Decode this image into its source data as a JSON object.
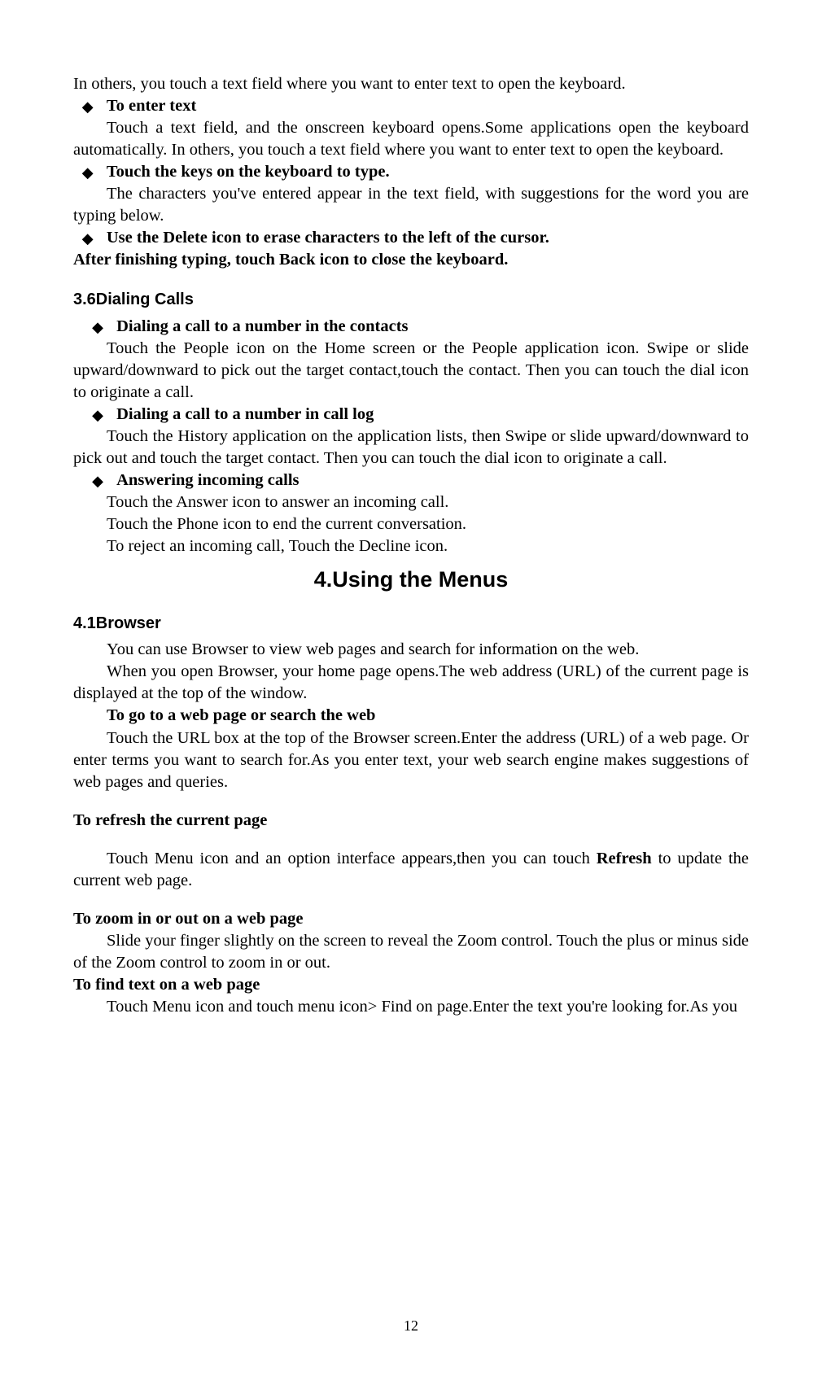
{
  "intro_line": "In others, you touch a text field where you want to enter text to open the keyboard.",
  "enter_text": {
    "heading": "To enter text",
    "body": "Touch a text field, and the onscreen keyboard opens.Some applications open the keyboard automatically. In others, you touch a text field where you want to enter text to open the keyboard."
  },
  "touch_keys": {
    "heading": "Touch the keys on the keyboard to type.",
    "body": "The characters you've entered appear in the text field, with suggestions for the word you are typing below."
  },
  "delete_icon": {
    "heading": "Use the Delete icon to erase characters to the left of the cursor."
  },
  "finish_typing": "After finishing typing, touch Back icon to close the keyboard.",
  "sec_36": {
    "title": "3.6Dialing Calls",
    "contacts": {
      "heading": "Dialing a call to a number in the contacts",
      "body": "Touch the People icon on the Home screen or the People application icon. Swipe or slide upward/downward to pick out the target contact,touch the contact. Then you can touch the dial icon to originate a call."
    },
    "call_log": {
      "heading": "Dialing a call to a number in call log",
      "body": "Touch the History application on the application lists, then Swipe or slide upward/downward to pick out and touch the target contact. Then you can touch the dial icon to originate a call."
    },
    "answering": {
      "heading": "Answering incoming calls",
      "line1": "Touch the Answer icon to answer an incoming call.",
      "line2": "Touch the Phone icon to end the current conversation.",
      "line3": "To reject an incoming call, Touch the Decline icon."
    }
  },
  "chapter4": {
    "title": "4.Using the Menus"
  },
  "sec_41": {
    "title": "4.1Browser",
    "intro1": "You can use Browser to view web pages and search for information on the web.",
    "intro2": "When you open Browser, your home page opens.The web address (URL) of the current page is displayed at the top of the window.",
    "goto": {
      "heading": "To go to a web page or search the web",
      "body": "Touch the URL box at the top of the Browser screen.Enter the address (URL) of a web page. Or enter terms you want to search for.As you enter text, your web search engine makes suggestions of web pages and queries."
    },
    "refresh": {
      "heading": "To refresh the current page",
      "body_pre": "Touch Menu icon and an option interface appears,then you can touch ",
      "body_bold": "Refresh",
      "body_post": " to update the current web page."
    },
    "zoom": {
      "heading": "To zoom in or out on a web page",
      "body": "Slide your finger slightly on the screen to reveal the Zoom control. Touch the plus or minus side of the Zoom control to zoom in or out."
    },
    "find": {
      "heading": "To find text on a web page",
      "body": "Touch Menu icon and touch menu icon> Find on page.Enter the text you're looking for.As you"
    }
  },
  "page_number": "12"
}
